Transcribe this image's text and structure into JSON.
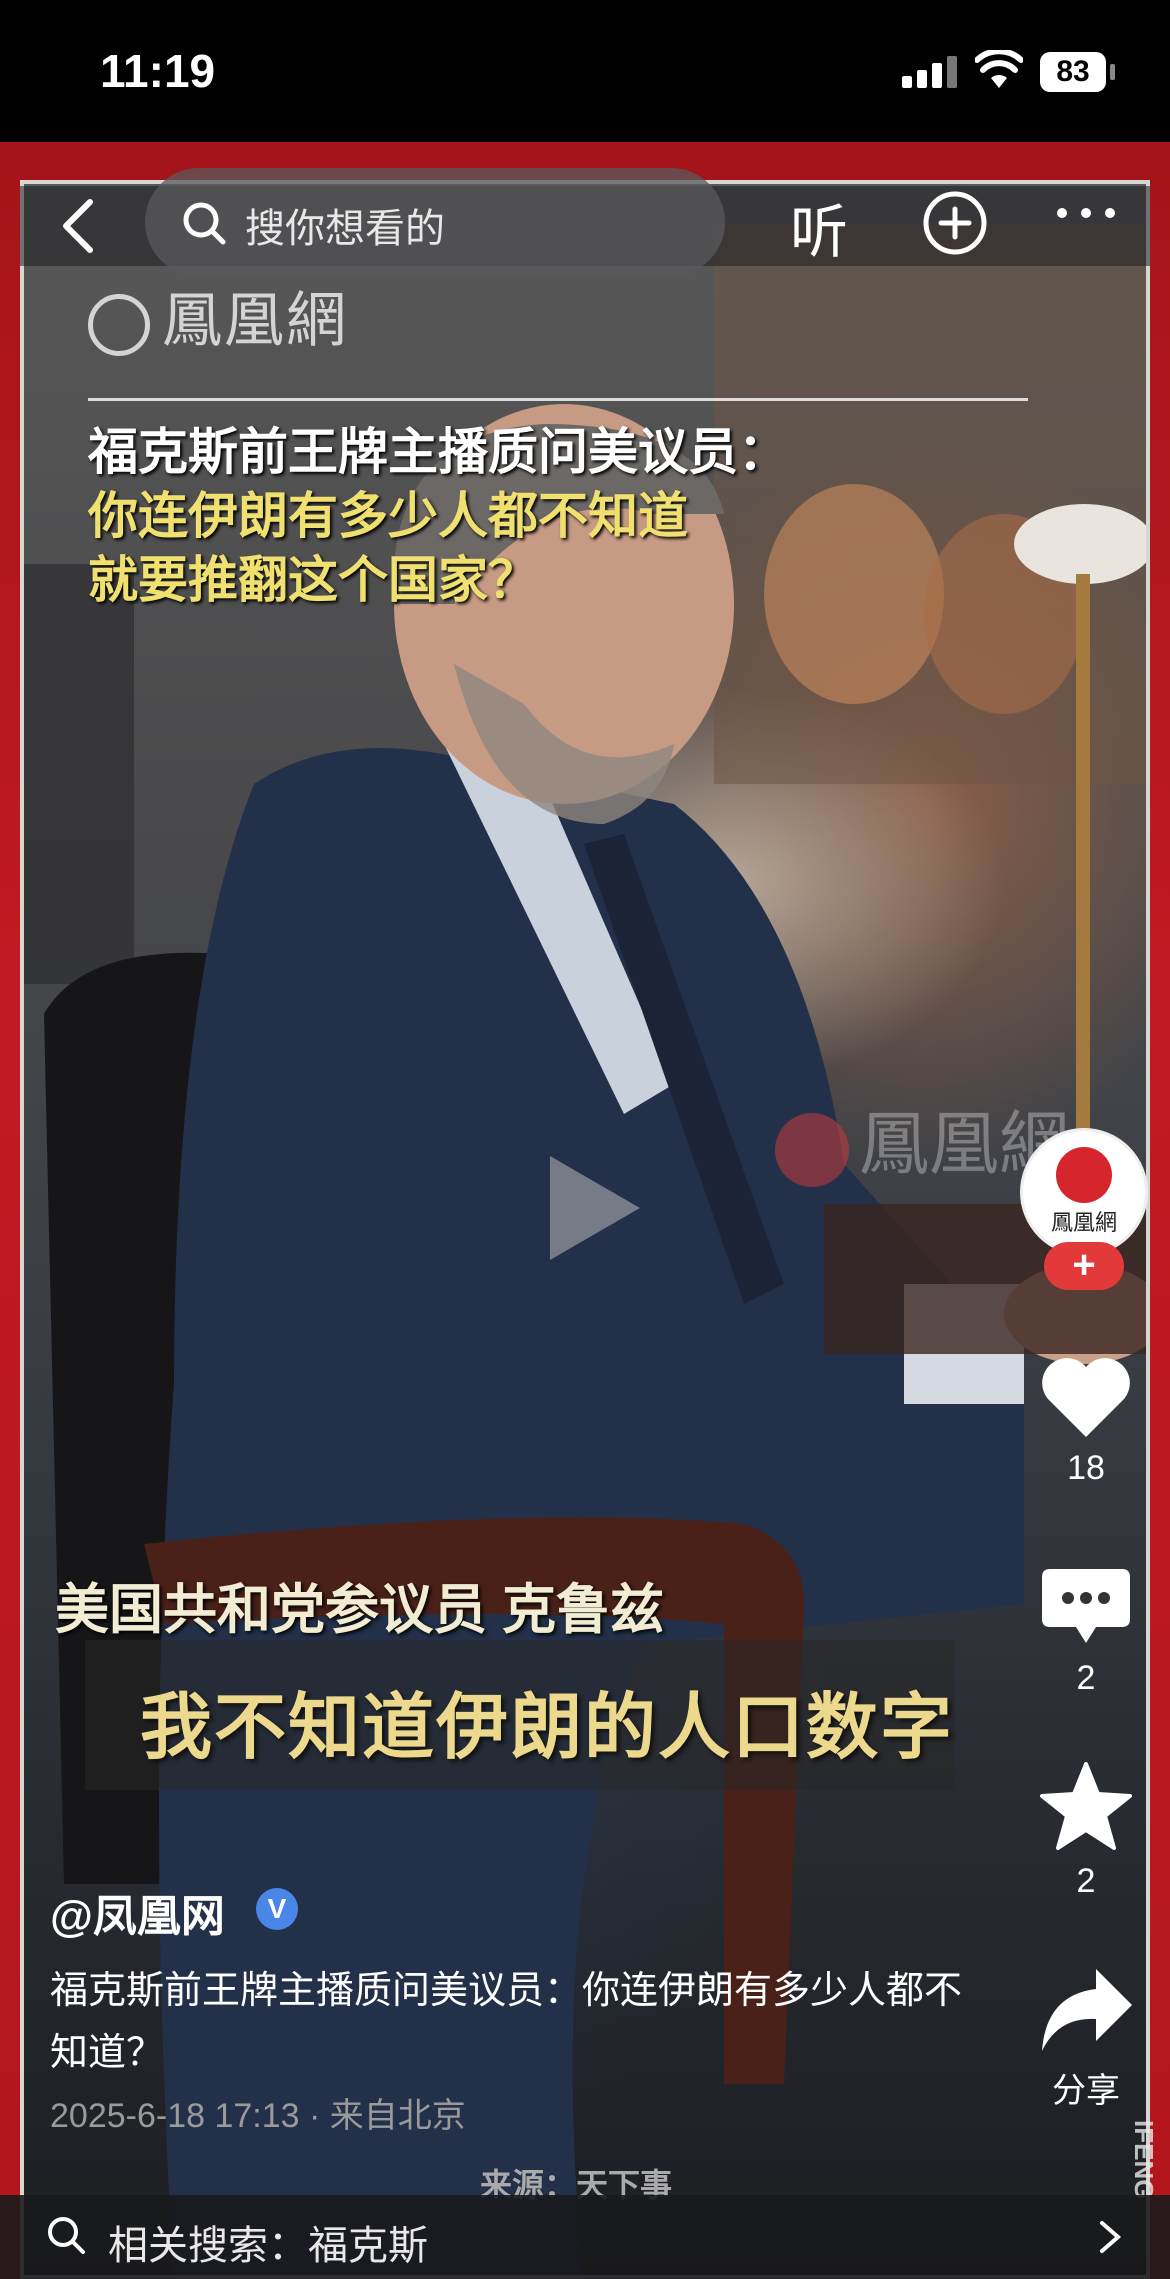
{
  "status_bar": {
    "time": "11:19",
    "battery": "83"
  },
  "topbar": {
    "search_placeholder": "搜你想看的",
    "listen_label": "听"
  },
  "video": {
    "logo_text": "鳳凰網",
    "headline_line1": "福克斯前王牌主播质问美议员：",
    "headline_line2": "你连伊朗有多少人都不知道",
    "headline_line3": "就要推翻这个国家？",
    "watermark": "鳳凰網",
    "speaker_caption": "美国共和党参议员 克鲁兹",
    "subtitle": "我不知道伊朗的人口数字"
  },
  "sidebar": {
    "avatar_label": "鳳凰網",
    "follow_symbol": "+",
    "like_count": "18",
    "comment_count": "2",
    "favorite_count": "2",
    "share_label": "分享"
  },
  "post": {
    "author": "@凤凰网",
    "verified": "V",
    "description": "福克斯前王牌主播质问美议员：你连伊朗有多少人都不知道？",
    "date": "2025-6-18 17:13",
    "location": "来自北京",
    "source": "来源：天下事"
  },
  "related_search": {
    "label": "相关搜索：福克斯"
  },
  "corner_stamp": "IFENG",
  "colors": {
    "frame_red": "#b3161c",
    "subtitle_yellow": "#ecd98d",
    "follow_red": "#e23a3a"
  }
}
